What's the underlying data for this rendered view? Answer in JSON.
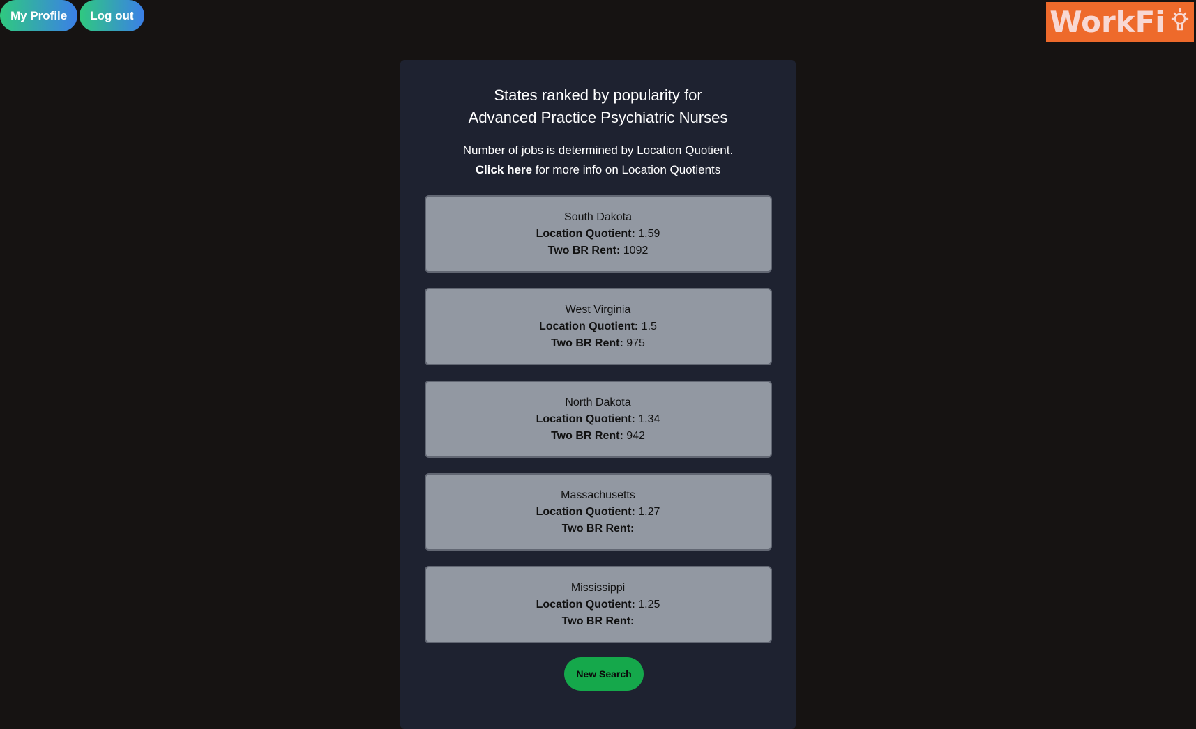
{
  "nav": {
    "profile_label": "My Profile",
    "logout_label": "Log out"
  },
  "logo": {
    "text": "WorkFi",
    "icon": "lightbulb-icon",
    "background": "#ee6a2b"
  },
  "heading": {
    "line1": "States ranked by popularity for",
    "line2": "Advanced Practice Psychiatric Nurses"
  },
  "info": {
    "line1": "Number of jobs is determined by Location Quotient.",
    "link_label": "Click here",
    "line2_rest": " for more info on Location Quotients"
  },
  "labels": {
    "lq": "Location Quotient:",
    "rent": "Two BR Rent:"
  },
  "states": [
    {
      "name": "South Dakota",
      "lq": "1.59",
      "rent": "1092"
    },
    {
      "name": "West Virginia",
      "lq": "1.5",
      "rent": "975"
    },
    {
      "name": "North Dakota",
      "lq": "1.34",
      "rent": "942"
    },
    {
      "name": "Massachusetts",
      "lq": "1.27",
      "rent": ""
    },
    {
      "name": "Mississippi",
      "lq": "1.25",
      "rent": ""
    }
  ],
  "actions": {
    "new_search_label": "New Search"
  },
  "colors": {
    "page_bg": "#161312",
    "card_bg": "#1e2230",
    "state_bg": "#9298a2",
    "button_green": "#15a84b",
    "gradient_start": "#2fc97f",
    "gradient_end": "#3b7fe8"
  }
}
